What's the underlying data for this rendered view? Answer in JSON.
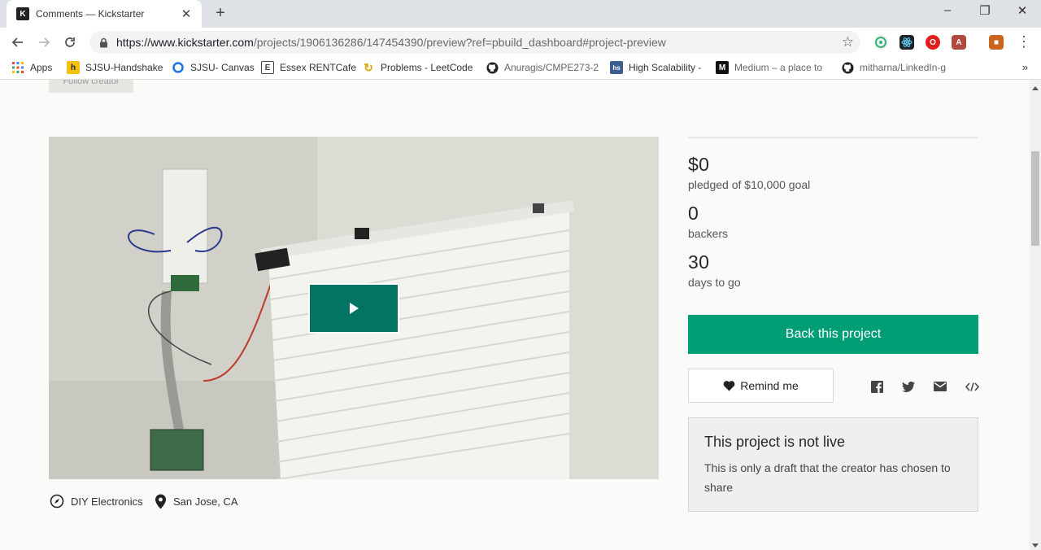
{
  "browser": {
    "tab_title": "Comments — Kickstarter",
    "tab_favicon": "K",
    "url_host": "https://www.kickstarter.com",
    "url_path": "/projects/1906136286/147454390/preview?ref=pbuild_dashboard#project-preview",
    "bookmarks": [
      {
        "label": "Apps",
        "icon": "apps-grid-icon"
      },
      {
        "label": "SJSU-Handshake",
        "icon": "handshake-icon"
      },
      {
        "label": "SJSU- Canvas",
        "icon": "canvas-icon"
      },
      {
        "label": "Essex RENTCafe",
        "icon": "essex-icon"
      },
      {
        "label": "Problems - LeetCode",
        "icon": "leetcode-icon"
      },
      {
        "label": "Anuragis/CMPE273-2",
        "icon": "github-icon"
      },
      {
        "label": "High Scalability -",
        "icon": "highscalability-icon"
      },
      {
        "label": "Medium – a place to",
        "icon": "medium-icon"
      },
      {
        "label": "mitharna/LinkedIn-g",
        "icon": "github-icon"
      }
    ],
    "more_bookmarks": "»"
  },
  "project": {
    "follow_label": "Follow creator",
    "category": "DIY Electronics",
    "location": "San Jose, CA"
  },
  "stats": {
    "pledged_value": "$0",
    "pledged_label": "pledged of $10,000 goal",
    "backers_value": "0",
    "backers_label": "backers",
    "days_value": "30",
    "days_label": "days to go"
  },
  "actions": {
    "back_label": "Back this project",
    "remind_label": "Remind me"
  },
  "notice": {
    "title": "This project is not live",
    "body": "This is only a draft that the creator has chosen to share"
  },
  "colors": {
    "primary_green": "#009e74",
    "play_green": "#037362"
  }
}
